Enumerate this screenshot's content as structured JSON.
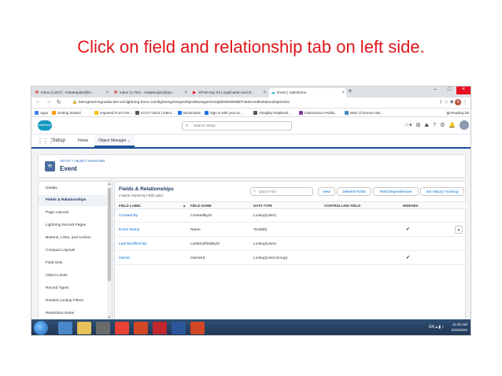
{
  "slide": {
    "title": "Click on field and relationship tab on left side."
  },
  "browser": {
    "tabs": [
      {
        "icon": "M",
        "label": "Inbox (1,837) - kshatrapalsi@in..."
      },
      {
        "icon": "M",
        "label": "Inbox (1,794) - malipsingh1@gm..."
      },
      {
        "icon": "▶",
        "label": "SPAB Day #2 | Application and D..."
      },
      {
        "icon": "☁",
        "label": "Event | Salesforce"
      }
    ],
    "new_tab": "+",
    "url": "bsengineeringnoida-dev-ed.lightning.force.com/lightning/setup/ObjectManager/01I5j000000lWBb/FieldsAndRelationships/view",
    "bookmarks": [
      {
        "label": "Apps",
        "color": "#4285f4"
      },
      {
        "label": "Getting Started",
        "color": "#ff9900"
      },
      {
        "label": "Imported From Fire...",
        "color": "#f4c20d"
      },
      {
        "label": "ICCCT 2014 | Intern...",
        "color": "#555555"
      },
      {
        "label": "Bookmarks",
        "color": "#1a73e8"
      },
      {
        "label": "Sign in with your ac...",
        "color": "#1a73e8"
      },
      {
        "label": "Almighty HelpDesk...",
        "color": "#555555"
      },
      {
        "label": "Inderscience Publis...",
        "color": "#7b3fa0"
      },
      {
        "label": "Web of Science Ma...",
        "color": "#3c8dbc"
      }
    ],
    "reading_list": "Reading list"
  },
  "salesforce": {
    "logo": "salesforce",
    "search_placeholder": "Search Setup",
    "app_name": "Setup",
    "nav_tabs": [
      "Home",
      "Object Manager ⌄"
    ],
    "breadcrumb": "SETUP > OBJECT MANAGER",
    "object_name": "Event",
    "left_nav": [
      "Details",
      "Fields & Relationships",
      "Page Layouts",
      "Lightning Record Pages",
      "Buttons, Links, and Actions",
      "Compact Layouts",
      "Field Sets",
      "Object Limits",
      "Record Types",
      "Related Lookup Filters",
      "Restriction Rules"
    ],
    "active_left_nav": "Fields & Relationships",
    "panel": {
      "title": "Fields & Relationships",
      "subtitle": "4 Items, Sorted by Field Label",
      "quick_find_placeholder": "Quick Find",
      "buttons": [
        "New",
        "Deleted Fields",
        "Field Dependencies",
        "Set History Tracking"
      ],
      "columns": [
        "FIELD LABEL",
        "FIELD NAME",
        "DATA TYPE",
        "CONTROLLING FIELD",
        "INDEXED"
      ],
      "sort_indicator": "▲",
      "rows": [
        {
          "label": "Created By",
          "name": "CreatedById",
          "type": "Lookup(User)",
          "controlling": "",
          "indexed": ""
        },
        {
          "label": "Event Name",
          "name": "Name",
          "type": "Text(80)",
          "controlling": "",
          "indexed": "✔"
        },
        {
          "label": "Last Modified By",
          "name": "LastModifiedById",
          "type": "Lookup(User)",
          "controlling": "",
          "indexed": ""
        },
        {
          "label": "Owner",
          "name": "OwnerId",
          "type": "Lookup(User,Group)",
          "controlling": "",
          "indexed": "✔"
        }
      ]
    }
  },
  "taskbar": {
    "lang": "EN",
    "time": "11:20 AM",
    "date": "2/25/2022"
  }
}
